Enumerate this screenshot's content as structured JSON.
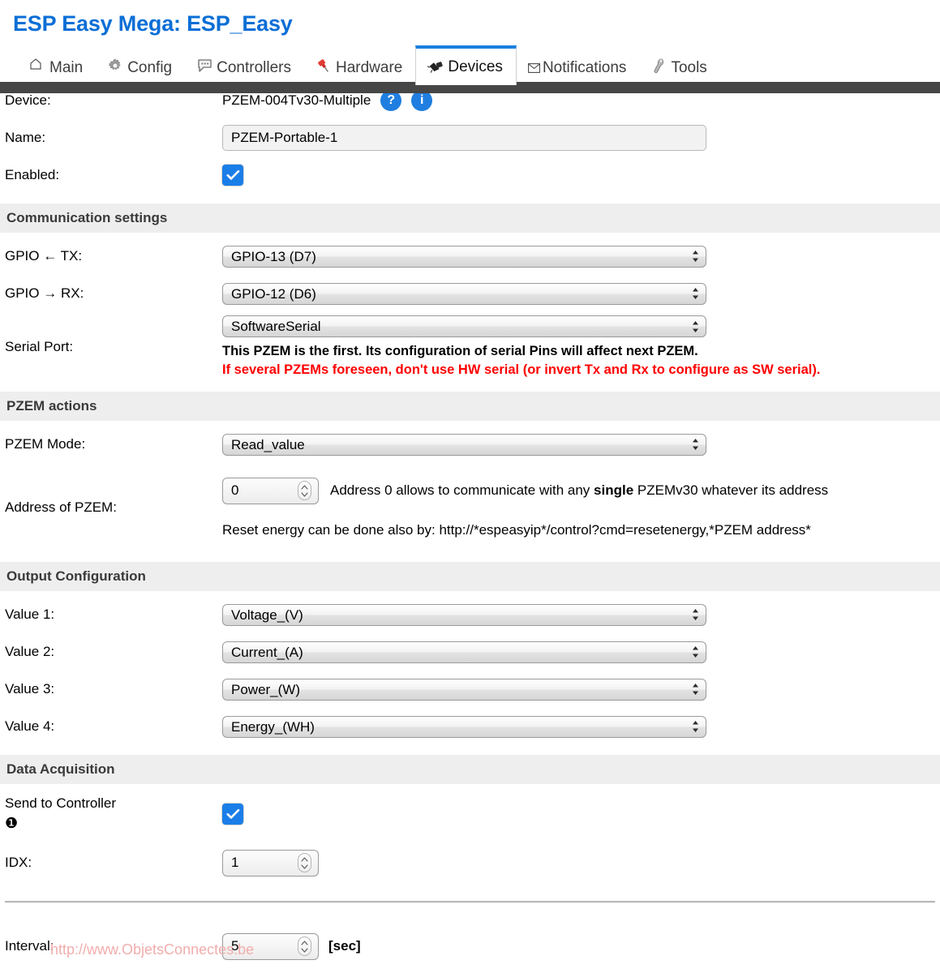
{
  "header": {
    "title": "ESP Easy Mega: ESP_Easy"
  },
  "tabs": [
    {
      "label": "Main",
      "icon": "home-icon",
      "active": false
    },
    {
      "label": "Config",
      "icon": "gear-icon",
      "active": false
    },
    {
      "label": "Controllers",
      "icon": "speech-bubble-icon",
      "active": false
    },
    {
      "label": "Hardware",
      "icon": "pushpin-icon",
      "active": false
    },
    {
      "label": "Devices",
      "icon": "plug-icon",
      "active": true
    },
    {
      "label": "Notifications",
      "icon": "envelope-icon",
      "active": false
    },
    {
      "label": "Tools",
      "icon": "wrench-icon",
      "active": false
    }
  ],
  "device": {
    "label": "Device:",
    "value": "PZEM-004Tv30-Multiple",
    "help_badge": "?",
    "info_badge": "i"
  },
  "name": {
    "label": "Name:",
    "value": "PZEM-Portable-1"
  },
  "enabled": {
    "label": "Enabled:",
    "checked": true
  },
  "communication": {
    "title": "Communication settings",
    "gpio_tx": {
      "label": "GPIO ← TX:",
      "value": "GPIO-13 (D7)"
    },
    "gpio_rx": {
      "label": "GPIO → RX:",
      "value": "GPIO-12 (D6)"
    },
    "serial_port": {
      "label": "Serial Port:",
      "value": "SoftwareSerial",
      "note_black": "This PZEM is the first. Its configuration of serial Pins will affect next PZEM.",
      "note_red": "If several PZEMs foreseen, don't use HW serial (or invert Tx and Rx to configure as SW serial)."
    }
  },
  "pzem_actions": {
    "title": "PZEM actions",
    "mode": {
      "label": "PZEM Mode:",
      "value": "Read_value"
    },
    "address": {
      "label": "Address of PZEM:",
      "value": "0",
      "hint_pre": "Address 0 allows to communicate with any ",
      "hint_bold": "single",
      "hint_post": " PZEMv30 whatever its address",
      "reset_hint": "Reset energy can be done also by: http://*espeasyip*/control?cmd=resetenergy,*PZEM address*"
    }
  },
  "output_configuration": {
    "title": "Output Configuration",
    "values": [
      {
        "label": "Value 1:",
        "value": "Voltage_(V)"
      },
      {
        "label": "Value 2:",
        "value": "Current_(A)"
      },
      {
        "label": "Value 3:",
        "value": "Power_(W)"
      },
      {
        "label": "Value 4:",
        "value": "Energy_(WH)"
      }
    ]
  },
  "data_acquisition": {
    "title": "Data Acquisition",
    "send_to_controller": {
      "label": "Send to Controller",
      "marker": "❶",
      "checked": true
    },
    "idx": {
      "label": "IDX:",
      "value": "1"
    },
    "interval": {
      "label": "Interval:",
      "value": "5",
      "unit": "[sec]"
    }
  },
  "watermark": {
    "text": "http://www.ObjetsConnectes.be"
  },
  "colors": {
    "title_blue": "#0a6ed6",
    "tab_active_border": "#1a7fe0",
    "dark_bar": "#464646",
    "section_bg": "#eeeeee",
    "checkbox_blue": "#1a7ee8",
    "badge_blue": "#1f7ee0",
    "warning_red": "#ff0000",
    "watermark_pink": "#f2adad"
  }
}
